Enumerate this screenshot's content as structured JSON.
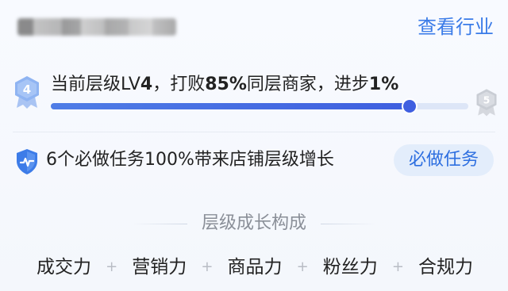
{
  "header": {
    "shop_name_redacted": true,
    "industry_link": "查看行业"
  },
  "level": {
    "current_badge": "4",
    "next_badge": "5",
    "text_prefix": "当前层级LV",
    "level_value": "4",
    "text_mid": "，打败",
    "beat_percent": "85%",
    "text_mid2": "同层商家，进步",
    "progress_delta": "1%",
    "progress_fraction": 0.86
  },
  "tasks": {
    "text": "6个必做任务100%带来店铺层级增长",
    "button_label": "必做任务",
    "icon": "shield-check-icon"
  },
  "growth": {
    "section_title": "层级成长构成",
    "plus_sign": "+",
    "factors": [
      "成交力",
      "营销力",
      "商品力",
      "粉丝力",
      "合规力"
    ]
  },
  "colors": {
    "accent": "#3a7be8",
    "progress": "#3f5fe0",
    "badge_current": "#8fb4f2",
    "badge_next": "#c9cdd4"
  }
}
